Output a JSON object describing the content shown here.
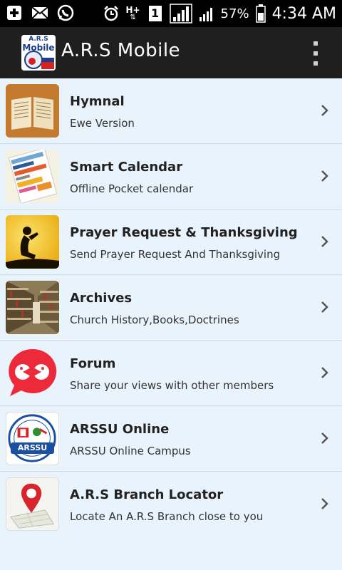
{
  "status_bar": {
    "battery_percent": "57%",
    "time": "4:34 AM",
    "sim_slot": "1",
    "network_type": "H+",
    "left_icons": [
      "add-notification-icon",
      "email-icon",
      "whatsapp-icon"
    ],
    "right_icons": [
      "alarm-icon",
      "network-type-icon",
      "sim-icon",
      "signal-icon",
      "signal-2-icon",
      "battery-icon"
    ]
  },
  "action_bar": {
    "title": "A.R.S Mobile",
    "logo_text_top": "A.R.S",
    "logo_text_main": "Mobile"
  },
  "menu": [
    {
      "title": "Hymnal",
      "subtitle": "Ewe Version",
      "icon": "hymnal-book-icon"
    },
    {
      "title": "Smart Calendar",
      "subtitle": "Offline Pocket calendar",
      "icon": "calendar-icon"
    },
    {
      "title": "Prayer Request & Thanksgiving",
      "subtitle": "Send Prayer Request And Thanksgiving",
      "icon": "prayer-icon"
    },
    {
      "title": "Archives",
      "subtitle": "Church History,Books,Doctrines",
      "icon": "archives-icon"
    },
    {
      "title": "Forum",
      "subtitle": "Share your views with other members",
      "icon": "forum-icon"
    },
    {
      "title": "ARSSU Online",
      "subtitle": "ARSSU Online Campus",
      "icon": "arssu-logo-icon",
      "badge_text": "ARSSU"
    },
    {
      "title": "A.R.S Branch Locator",
      "subtitle": "Locate An A.R.S Branch close to you",
      "icon": "map-pin-icon"
    }
  ],
  "colors": {
    "background": "#e9f3fb",
    "action_bar": "#1f1f1f",
    "divider": "#cfdce6"
  }
}
